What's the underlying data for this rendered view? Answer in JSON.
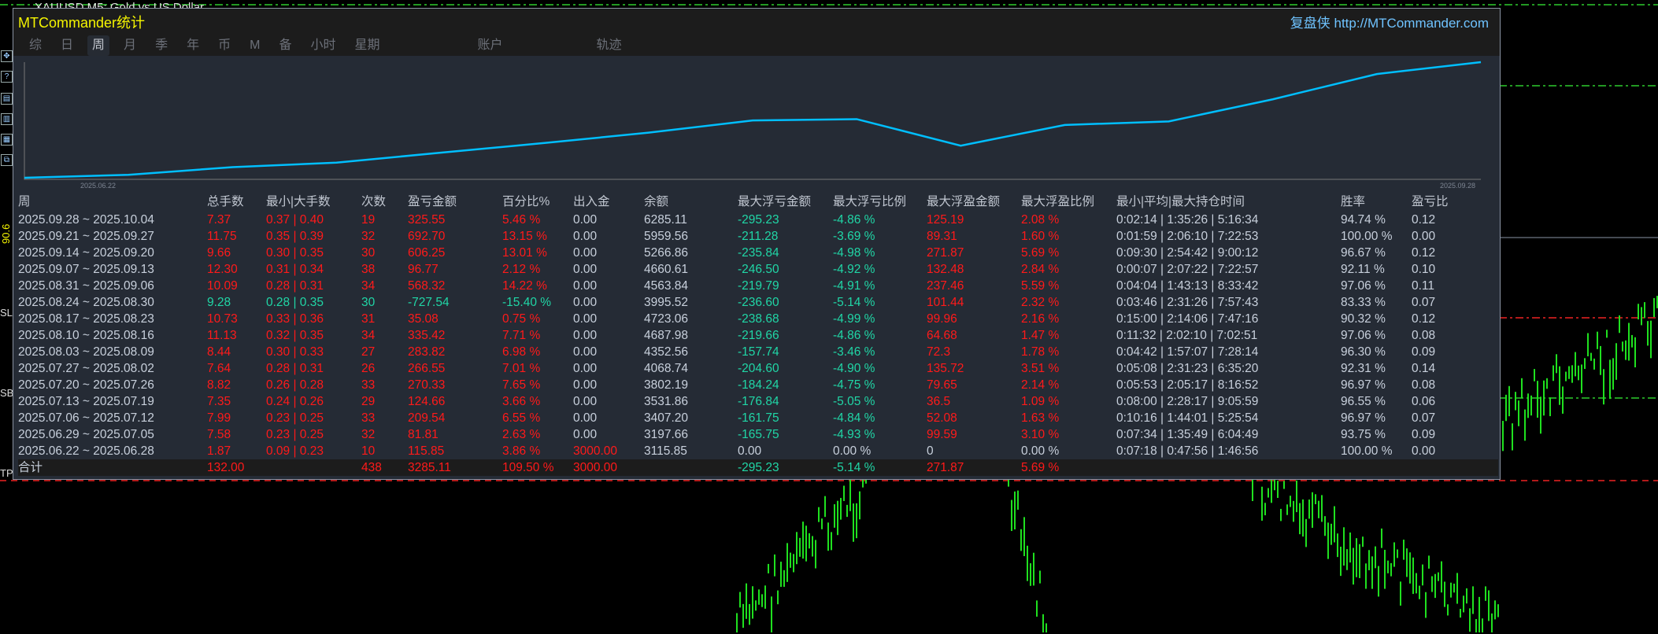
{
  "chart_title_bar": {
    "symbol_text": "XAUUSD,M5: Gold vs US Dollar"
  },
  "toolbar": {
    "icons": [
      "table-icon",
      "chart-icon"
    ],
    "side_labels": [
      "90.6 V",
      "SL",
      "SB",
      "TP"
    ]
  },
  "panel": {
    "title": "MTCommander统计",
    "link": "复盘侠 http://MTCommander.com",
    "tabs": [
      {
        "label": "综",
        "active": false
      },
      {
        "label": "日",
        "active": false
      },
      {
        "label": "周",
        "active": true
      },
      {
        "label": "月",
        "active": false
      },
      {
        "label": "季",
        "active": false
      },
      {
        "label": "年",
        "active": false
      },
      {
        "label": "币",
        "active": false
      },
      {
        "label": "M",
        "active": false
      },
      {
        "label": "备",
        "active": false
      },
      {
        "label": "小时",
        "active": false
      },
      {
        "label": "星期",
        "active": false
      },
      {
        "label": "账户",
        "active": false
      },
      {
        "label": "轨迹",
        "active": false
      }
    ]
  },
  "chart_data": {
    "type": "line",
    "title": "",
    "x_labels": [
      "2025.06.22",
      "2025.09.28"
    ],
    "x": [
      "2025.06.22",
      "2025.06.29",
      "2025.07.06",
      "2025.07.13",
      "2025.07.20",
      "2025.07.27",
      "2025.08.03",
      "2025.08.10",
      "2025.08.17",
      "2025.08.24",
      "2025.08.31",
      "2025.09.07",
      "2025.09.14",
      "2025.09.21",
      "2025.09.28"
    ],
    "series": [
      {
        "name": "余额",
        "values": [
          3115.85,
          3197.66,
          3407.2,
          3531.86,
          3802.19,
          4068.74,
          4352.56,
          4687.98,
          4723.06,
          3995.52,
          4563.84,
          4660.61,
          5266.86,
          5959.56,
          6285.11
        ]
      }
    ],
    "color": "#00bfff"
  },
  "table": {
    "headers": [
      "周",
      "总手数",
      "最小|大手数",
      "次数",
      "盈亏金额",
      "百分比%",
      "出入金",
      "余额",
      "最大浮亏金额",
      "最大浮亏比例",
      "最大浮盈金额",
      "最大浮盈比例",
      "最小|平均|最大持仓时间",
      "胜率",
      "盈亏比"
    ],
    "rows": [
      {
        "tone": "profit",
        "cells": [
          "2025.09.28 ~ 2025.10.04",
          "7.37",
          "0.37 | 0.40",
          "19",
          "325.55",
          "5.46 %",
          "0.00",
          "6285.11",
          "-295.23",
          "-4.86 %",
          "125.19",
          "2.08 %",
          "0:02:14 | 1:35:26 | 5:16:34",
          "94.74 %",
          "0.12"
        ]
      },
      {
        "tone": "profit",
        "cells": [
          "2025.09.21 ~ 2025.09.27",
          "11.75",
          "0.35 | 0.39",
          "32",
          "692.70",
          "13.15 %",
          "0.00",
          "5959.56",
          "-211.28",
          "-3.69 %",
          "89.31",
          "1.60 %",
          "0:01:59 | 2:06:10 | 7:22:53",
          "100.00 %",
          "0.00"
        ]
      },
      {
        "tone": "profit",
        "cells": [
          "2025.09.14 ~ 2025.09.20",
          "9.66",
          "0.30 | 0.35",
          "30",
          "606.25",
          "13.01 %",
          "0.00",
          "5266.86",
          "-235.84",
          "-4.98 %",
          "271.87",
          "5.69 %",
          "0:09:30 | 2:54:42 | 9:00:12",
          "96.67 %",
          "0.12"
        ]
      },
      {
        "tone": "profit",
        "cells": [
          "2025.09.07 ~ 2025.09.13",
          "12.30",
          "0.31 | 0.34",
          "38",
          "96.77",
          "2.12 %",
          "0.00",
          "4660.61",
          "-246.50",
          "-4.92 %",
          "132.48",
          "2.84 %",
          "0:00:07 | 2:07:22 | 7:22:57",
          "92.11 %",
          "0.10"
        ]
      },
      {
        "tone": "profit",
        "cells": [
          "2025.08.31 ~ 2025.09.06",
          "10.09",
          "0.28 | 0.31",
          "34",
          "568.32",
          "14.22 %",
          "0.00",
          "4563.84",
          "-219.79",
          "-4.91 %",
          "237.46",
          "5.59 %",
          "0:04:04 | 1:43:13 | 8:33:42",
          "97.06 %",
          "0.11"
        ]
      },
      {
        "tone": "loss",
        "cells": [
          "2025.08.24 ~ 2025.08.30",
          "9.28",
          "0.28 | 0.35",
          "30",
          "-727.54",
          "-15.40 %",
          "0.00",
          "3995.52",
          "-236.60",
          "-5.14 %",
          "101.44",
          "2.32 %",
          "0:03:46 | 2:31:26 | 7:57:43",
          "83.33 %",
          "0.07"
        ]
      },
      {
        "tone": "profit",
        "cells": [
          "2025.08.17 ~ 2025.08.23",
          "10.73",
          "0.33 | 0.36",
          "31",
          "35.08",
          "0.75 %",
          "0.00",
          "4723.06",
          "-238.68",
          "-4.99 %",
          "99.96",
          "2.16 %",
          "0:15:00 | 2:14:06 | 7:47:16",
          "90.32 %",
          "0.12"
        ]
      },
      {
        "tone": "profit",
        "cells": [
          "2025.08.10 ~ 2025.08.16",
          "11.13",
          "0.32 | 0.35",
          "34",
          "335.42",
          "7.71 %",
          "0.00",
          "4687.98",
          "-219.66",
          "-4.86 %",
          "64.68",
          "1.47 %",
          "0:11:32 | 2:02:10 | 7:02:51",
          "97.06 %",
          "0.08"
        ]
      },
      {
        "tone": "profit",
        "cells": [
          "2025.08.03 ~ 2025.08.09",
          "8.44",
          "0.30 | 0.33",
          "27",
          "283.82",
          "6.98 %",
          "0.00",
          "4352.56",
          "-157.74",
          "-3.46 %",
          "72.3",
          "1.78 %",
          "0:04:42 | 1:57:07 | 7:28:14",
          "96.30 %",
          "0.09"
        ]
      },
      {
        "tone": "profit",
        "cells": [
          "2025.07.27 ~ 2025.08.02",
          "7.64",
          "0.28 | 0.31",
          "26",
          "266.55",
          "7.01 %",
          "0.00",
          "4068.74",
          "-204.60",
          "-4.90 %",
          "135.72",
          "3.51 %",
          "0:05:08 | 2:31:23 | 6:35:20",
          "92.31 %",
          "0.14"
        ]
      },
      {
        "tone": "profit",
        "cells": [
          "2025.07.20 ~ 2025.07.26",
          "8.82",
          "0.26 | 0.28",
          "33",
          "270.33",
          "7.65 %",
          "0.00",
          "3802.19",
          "-184.24",
          "-4.75 %",
          "79.65",
          "2.14 %",
          "0:05:53 | 2:05:17 | 8:16:52",
          "96.97 %",
          "0.08"
        ]
      },
      {
        "tone": "profit",
        "cells": [
          "2025.07.13 ~ 2025.07.19",
          "7.35",
          "0.24 | 0.26",
          "29",
          "124.66",
          "3.66 %",
          "0.00",
          "3531.86",
          "-176.84",
          "-5.05 %",
          "36.5",
          "1.09 %",
          "0:08:00 | 2:28:17 | 9:05:59",
          "96.55 %",
          "0.06"
        ]
      },
      {
        "tone": "profit",
        "cells": [
          "2025.07.06 ~ 2025.07.12",
          "7.99",
          "0.23 | 0.25",
          "33",
          "209.54",
          "6.55 %",
          "0.00",
          "3407.20",
          "-161.75",
          "-4.84 %",
          "52.08",
          "1.63 %",
          "0:10:16 | 1:44:01 | 5:25:54",
          "96.97 %",
          "0.07"
        ]
      },
      {
        "tone": "profit",
        "cells": [
          "2025.06.29 ~ 2025.07.05",
          "7.58",
          "0.23 | 0.25",
          "32",
          "81.81",
          "2.63 %",
          "0.00",
          "3197.66",
          "-165.75",
          "-4.93 %",
          "99.59",
          "3.10 %",
          "0:07:34 | 1:35:49 | 6:04:49",
          "93.75 %",
          "0.09"
        ]
      },
      {
        "tone": "profit",
        "cells": [
          "2025.06.22 ~ 2025.06.28",
          "1.87",
          "0.09 | 0.23",
          "10",
          "115.85",
          "3.86 %",
          "3000.00",
          "3115.85",
          "0.00",
          "0.00 %",
          "0",
          "0.00 %",
          "0:07:18 | 0:47:56 | 1:46:56",
          "100.00 %",
          "0.00"
        ]
      }
    ],
    "total": {
      "tone": "profit",
      "cells": [
        "合计",
        "132.00",
        "",
        "438",
        "3285.11",
        "109.50 %",
        "3000.00",
        "",
        "-295.23",
        "-5.14 %",
        "271.87",
        "5.69 %",
        "",
        "",
        ""
      ]
    }
  },
  "colors": {
    "profit": "#ff1a1a",
    "loss": "#20d6a6",
    "neutral": "#c8d0dc",
    "line": "#00bfff"
  }
}
